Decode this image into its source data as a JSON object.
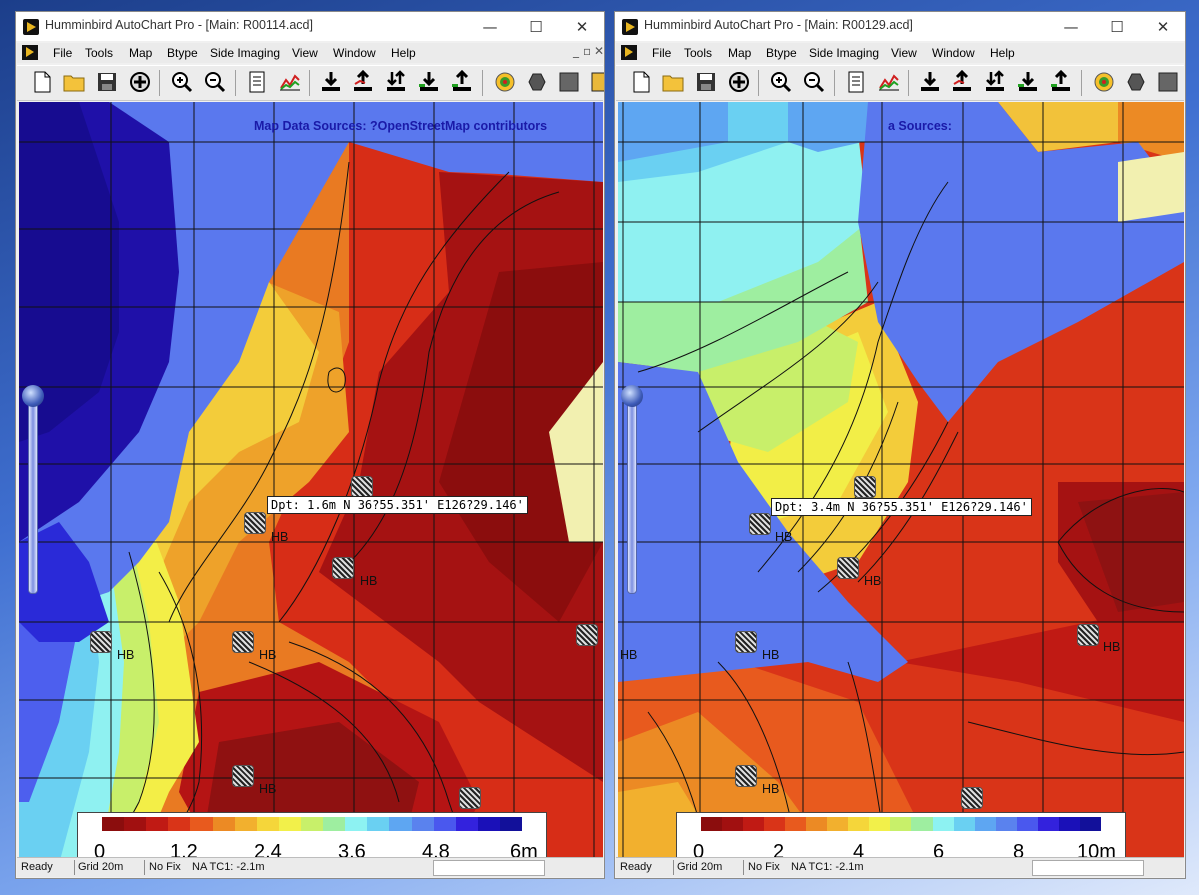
{
  "windows": [
    {
      "title": "Humminbird AutoChart Pro - [Main: R00114.acd]",
      "controls": {
        "minimize": "—",
        "maximize": "☐",
        "close": "✕"
      },
      "menu": [
        "File",
        "Tools",
        "Map",
        "Btype",
        "Side Imaging",
        "View",
        "Window",
        "Help"
      ],
      "map": {
        "credits": "Map Data Sources: ?OpenStreetMap contributors",
        "depth_readout": "Dpt: 1.6m N 36?55.351' E126?29.146'",
        "marker_label": "HB",
        "legend": {
          "ticks": [
            "0",
            "1.2",
            "2.4",
            "3.6",
            "4.8",
            "6m"
          ],
          "colors": [
            "#8b0d0d",
            "#a11010",
            "#c01a14",
            "#d93418",
            "#e85a1e",
            "#ec8a24",
            "#f2b02e",
            "#f5d63a",
            "#f2f04a",
            "#c8f06a",
            "#9eeea0",
            "#8df2f2",
            "#6ad0f2",
            "#5ea6f2",
            "#5a82ee",
            "#4a58ee",
            "#3322dd",
            "#1a10b8",
            "#12109a"
          ]
        }
      },
      "status": {
        "ready": "Ready",
        "grid": "Grid 20m",
        "fix": "No Fix",
        "tc": "NA  TC1: -2.1m"
      }
    },
    {
      "title": "Humminbird AutoChart Pro - [Main: R00129.acd]",
      "controls": {
        "minimize": "—",
        "maximize": "☐",
        "close": "✕"
      },
      "menu": [
        "File",
        "Tools",
        "Map",
        "Btype",
        "Side Imaging",
        "View",
        "Window",
        "Help"
      ],
      "map": {
        "credits": "a Sources:",
        "depth_readout": "Dpt: 3.4m N 36?55.351' E126?29.146'",
        "marker_label": "HB",
        "legend": {
          "ticks": [
            "0",
            "2",
            "4",
            "6",
            "8",
            "10m"
          ],
          "colors": [
            "#8b0d0d",
            "#a11010",
            "#c01a14",
            "#d93418",
            "#e85a1e",
            "#ec8a24",
            "#f2b02e",
            "#f5d63a",
            "#f2f04a",
            "#c8f06a",
            "#9eeea0",
            "#8df2f2",
            "#6ad0f2",
            "#5ea6f2",
            "#5a82ee",
            "#4a58ee",
            "#3322dd",
            "#1a10b8",
            "#12109a"
          ]
        }
      },
      "status": {
        "ready": "Ready",
        "grid": "Grid 20m",
        "fix": "No Fix",
        "tc": "NA  TC1: -2.1m"
      }
    }
  ]
}
